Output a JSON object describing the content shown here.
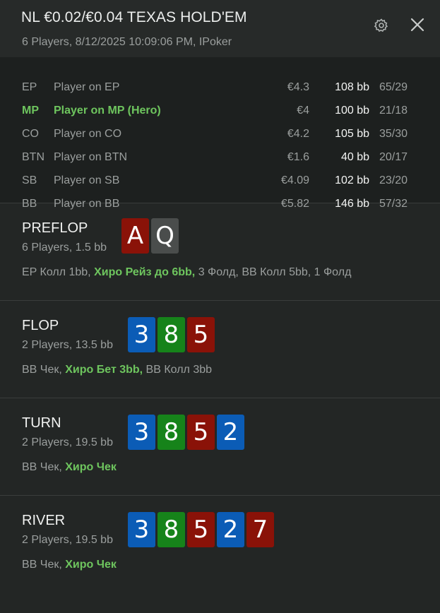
{
  "header": {
    "title": "NL €0.02/€0.04 TEXAS HOLD'EM",
    "subtitle": "6 Players, 8/12/2025 10:09:06 PM, IPoker",
    "settings_icon": "gear-icon",
    "close_icon": "close-icon"
  },
  "players": [
    {
      "pos": "EP",
      "name": "Player on EP",
      "money": "€4.3",
      "bb": "108 bb",
      "stat": "65/29"
    },
    {
      "pos": "MP",
      "name": "Player on MP (Hero)",
      "money": "€4",
      "bb": "100 bb",
      "stat": "21/18"
    },
    {
      "pos": "CO",
      "name": "Player on CO",
      "money": "€4.2",
      "bb": "105 bb",
      "stat": "35/30"
    },
    {
      "pos": "BTN",
      "name": "Player on BTN",
      "money": "€1.6",
      "bb": "40 bb",
      "stat": "20/17"
    },
    {
      "pos": "SB",
      "name": "Player on SB",
      "money": "€4.09",
      "bb": "102 bb",
      "stat": "23/20"
    },
    {
      "pos": "BB",
      "name": "Player on BB",
      "money": "€5.82",
      "bb": "146 bb",
      "stat": "57/32"
    }
  ],
  "colors": {
    "hero": "#6ec55e",
    "card_red": "#8a1208",
    "card_gray": "#4a4d4c",
    "card_blue": "#0b5cb6",
    "card_green": "#16831a"
  },
  "streets": {
    "preflop": {
      "name": "PREFLOP",
      "info": "6 Players, 1.5 bb",
      "cards": [
        "A",
        "Q"
      ],
      "actions": {
        "a1": "EP Колл 1bb, ",
        "hero": "Хиро Рейз до 6bb,",
        "a2": " 3 Фолд, BB Колл 5bb, 1 Фолд"
      }
    },
    "flop": {
      "name": "FLOP",
      "info": "2 Players, 13.5 bb",
      "cards": [
        "3",
        "8",
        "5"
      ],
      "actions": {
        "a1": "BB Чек, ",
        "hero": "Хиро Бет 3bb,",
        "a2": " BB Колл 3bb"
      }
    },
    "turn": {
      "name": "TURN",
      "info": "2 Players, 19.5 bb",
      "cards": [
        "3",
        "8",
        "5",
        "2"
      ],
      "actions": {
        "a1": "BB Чек, ",
        "hero": "Хиро Чек"
      }
    },
    "river": {
      "name": "RIVER",
      "info": "2 Players, 19.5 bb",
      "cards": [
        "3",
        "8",
        "5",
        "2",
        "7"
      ],
      "actions": {
        "a1": "BB Чек, ",
        "hero": "Хиро Чек"
      }
    }
  }
}
